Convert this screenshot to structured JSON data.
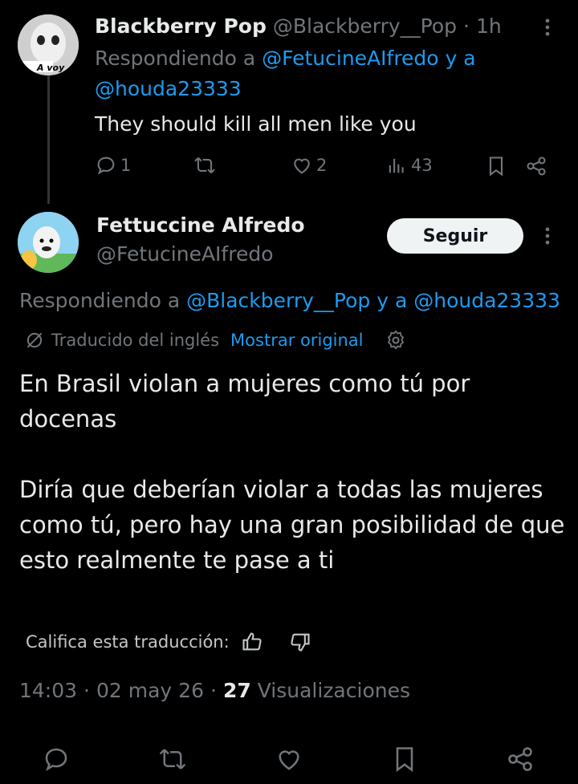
{
  "reply": {
    "name": "Blackberry Pop",
    "handle": "@Blackberry__Pop",
    "separator": "·",
    "time": "1h",
    "avatar_text": "A voy",
    "replying_prefix": "Respondiendo a",
    "replying_user1": "@FetucineAIfredo",
    "replying_and": "y a",
    "replying_user2": "@houda23333",
    "text": "They should kill all men like you",
    "replies": "1",
    "reposts": "",
    "likes": "2",
    "views": "43"
  },
  "main": {
    "name": "Fettuccine Alfredo",
    "handle": "@FetucineAIfredo",
    "follow_label": "Seguir",
    "replying_prefix": "Respondiendo a",
    "replying_user1": "@Blackberry__Pop",
    "replying_and": "y a",
    "replying_user2": "@houda23333",
    "translated_label": "Traducido del inglés",
    "show_original": "Mostrar original",
    "paragraph1": "En Brasil violan a mujeres como tú por docenas",
    "paragraph2": "Diría que deberían violar a todas las mujeres como tú, pero hay una gran posibilidad de que esto realmente te pase a ti",
    "rate_label": "Califica esta traducción:",
    "time": "14:03",
    "date": "02 may 26",
    "dot": "·",
    "views_count": "27",
    "views_label": "Visualizaciones"
  },
  "colors": {
    "background": "#000000",
    "text": "#e7e9ea",
    "muted": "#71767b",
    "link": "#1d9bf0"
  },
  "icons": [
    "reply-icon",
    "repost-icon",
    "like-icon",
    "views-icon",
    "bookmark-icon",
    "share-icon",
    "more-icon",
    "translate-icon",
    "settings-icon",
    "thumbs-up-icon",
    "thumbs-down-icon"
  ]
}
